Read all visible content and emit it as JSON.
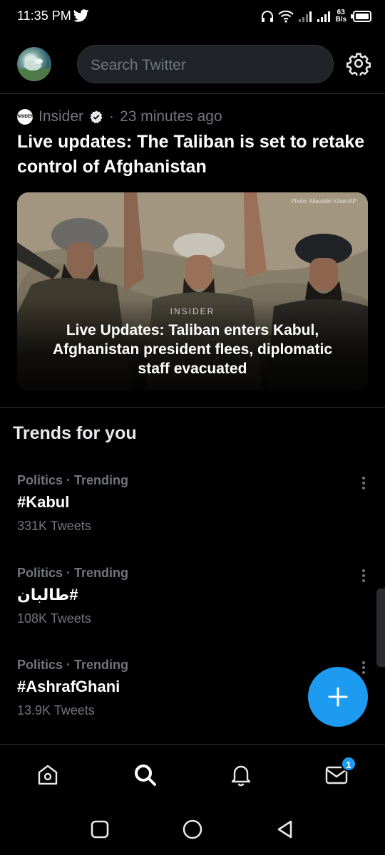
{
  "status_bar": {
    "time": "11:35 PM",
    "net_speed_top": "63",
    "net_speed_bottom": "B/s",
    "icons": [
      "twitter-bird-icon",
      "headphones-icon",
      "wifi-icon",
      "signal-icon",
      "signal-icon",
      "battery-icon"
    ]
  },
  "top_bar": {
    "search_placeholder": "Search Twitter",
    "settings_icon": "gear-icon"
  },
  "news": {
    "source": "Insider",
    "source_logo_text": "INSIDER",
    "separator": "·",
    "time_ago": "23 minutes ago",
    "headline": "Live updates: The Taliban is set to retake control of Afghanistan",
    "image": {
      "credit": "Photo: Allauddin Khan/AP",
      "brand": "INSIDER",
      "caption": "Live Updates: Taliban enters Kabul, Afghanistan president flees, diplomatic staff evacuated"
    }
  },
  "trends": {
    "title": "Trends for you",
    "items": [
      {
        "category": "Politics · Trending",
        "name": "#Kabul",
        "count": "331K Tweets"
      },
      {
        "category": "Politics · Trending",
        "name": "#طالبان",
        "count": "108K Tweets"
      },
      {
        "category": "Politics · Trending",
        "name": "#AshrafGhani",
        "count": "13.9K Tweets"
      }
    ]
  },
  "bottom_nav": {
    "items": [
      "home-icon",
      "search-icon",
      "notifications-icon",
      "messages-icon"
    ],
    "messages_badge": "1"
  },
  "colors": {
    "background": "#000000",
    "accent": "#1d9bf0",
    "secondary_text": "#71767b",
    "divider": "#2f3336"
  }
}
